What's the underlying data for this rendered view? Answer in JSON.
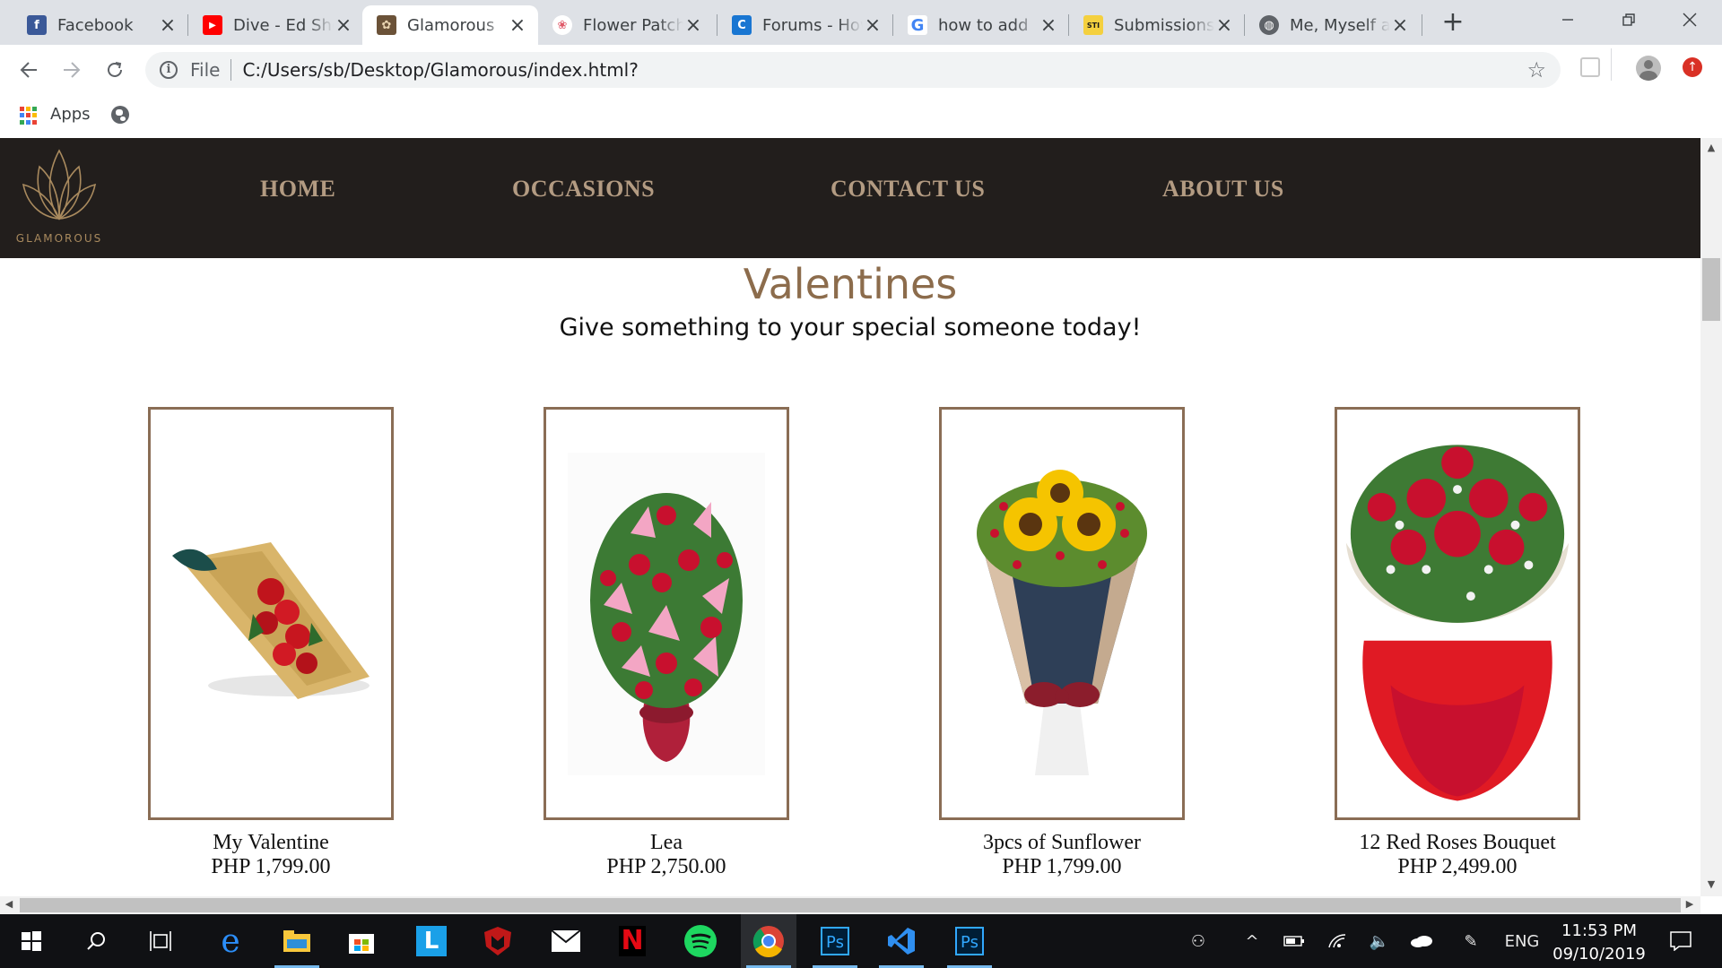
{
  "browser": {
    "tabs": [
      {
        "title": "Facebook",
        "icon": "facebook-icon",
        "color": "#3b5998",
        "glyph": "f"
      },
      {
        "title": "Dive - Ed Sheeran",
        "icon": "youtube-icon",
        "color": "#ff0000",
        "glyph": "▶"
      },
      {
        "title": "Glamorous",
        "icon": "glamorous-favicon",
        "color": "#a98a5e",
        "glyph": "✿",
        "active": true
      },
      {
        "title": "Flower Patch",
        "icon": "flower-patch-icon",
        "color": "#f08080",
        "glyph": "❀"
      },
      {
        "title": "Forums - How",
        "icon": "forums-icon",
        "color": "#1976d2",
        "glyph": "C"
      },
      {
        "title": "how to add",
        "icon": "google-icon",
        "color": "#4285f4",
        "glyph": "G"
      },
      {
        "title": "Submissions",
        "icon": "sti-icon",
        "color": "#f4d03f",
        "glyph": "STI"
      },
      {
        "title": "Me, Myself and",
        "icon": "globe-icon",
        "color": "#5f6368",
        "glyph": "◍"
      }
    ],
    "address": {
      "scheme": "File",
      "url": "C:/Users/sb/Desktop/Glamorous/index.html?"
    },
    "bookmarks": {
      "apps_label": "Apps"
    }
  },
  "site": {
    "logo_text": "GLAMOROUS",
    "nav": [
      "HOME",
      "OCCASIONS",
      "CONTACT US",
      "ABOUT US"
    ],
    "heading": "Valentines",
    "subheading": "Give something to your special someone today!",
    "products": [
      {
        "name": "My Valentine",
        "price": "PHP 1,799.00"
      },
      {
        "name": "Lea",
        "price": "PHP 2,750.00"
      },
      {
        "name": "3pcs of Sunflower",
        "price": "PHP 1,799.00"
      },
      {
        "name": "12 Red Roses Bouquet",
        "price": "PHP 2,499.00"
      }
    ],
    "colors": {
      "nav_bg": "#221e1c",
      "nav_text": "#b39b82",
      "accent": "#8c6c4c"
    }
  },
  "taskbar": {
    "lang": "ENG",
    "time": "11:53 PM",
    "date": "09/10/2019"
  }
}
